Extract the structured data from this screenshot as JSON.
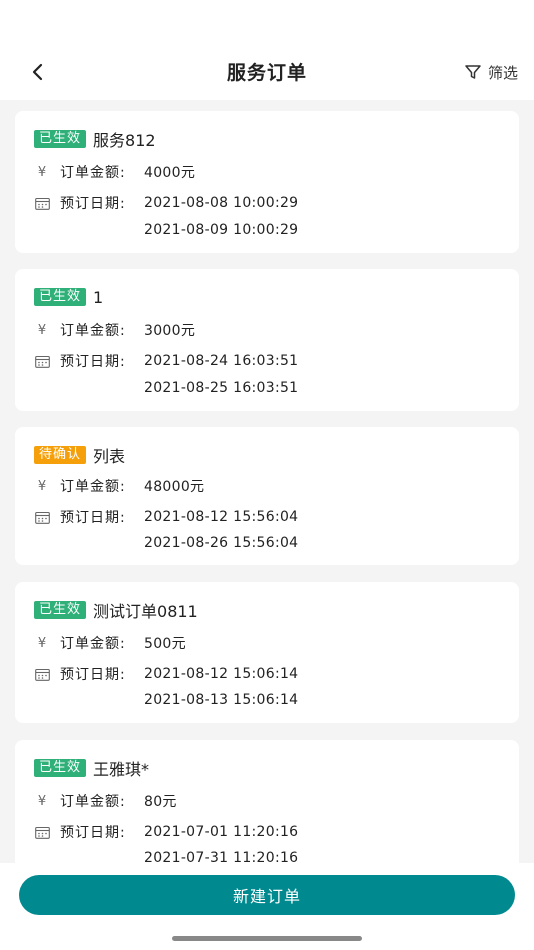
{
  "header": {
    "title": "服务订单",
    "filter_label": "筛选"
  },
  "labels": {
    "amount": "订单金额:",
    "date": "预订日期:",
    "currency_symbol": "¥"
  },
  "orders": [
    {
      "status": "已生效",
      "status_type": "active",
      "name": "服务812",
      "amount": "4000元",
      "start": "2021-08-08 10:00:29",
      "end": "2021-08-09 10:00:29"
    },
    {
      "status": "已生效",
      "status_type": "active",
      "name": "1",
      "amount": "3000元",
      "start": "2021-08-24 16:03:51",
      "end": "2021-08-25 16:03:51"
    },
    {
      "status": "待确认",
      "status_type": "pending",
      "name": "列表",
      "amount": "48000元",
      "start": "2021-08-12 15:56:04",
      "end": "2021-08-26 15:56:04"
    },
    {
      "status": "已生效",
      "status_type": "active",
      "name": "测试订单0811",
      "amount": "500元",
      "start": "2021-08-12 15:06:14",
      "end": "2021-08-13 15:06:14"
    },
    {
      "status": "已生效",
      "status_type": "active",
      "name": "王雅琪*",
      "amount": "80元",
      "start": "2021-07-01 11:20:16",
      "end": "2021-07-31 11:20:16"
    }
  ],
  "footer": {
    "create_label": "新建订单"
  },
  "colors": {
    "active": "#2fb079",
    "pending": "#f5a00b",
    "primary": "#008a8f"
  }
}
